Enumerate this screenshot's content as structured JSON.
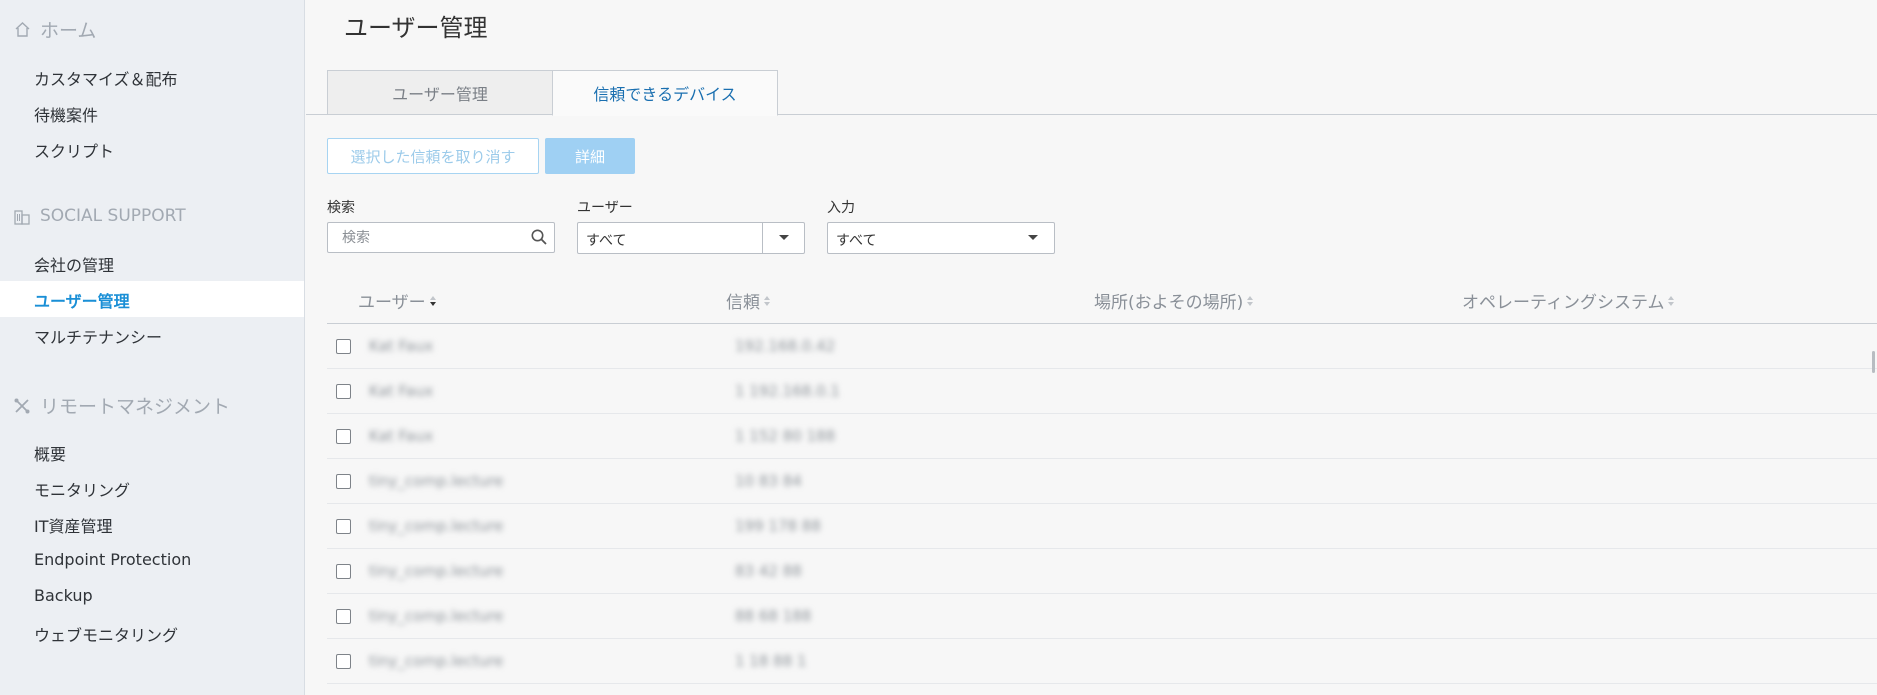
{
  "sidebar": {
    "home": {
      "label": "ホーム",
      "icon": "home-icon"
    },
    "home_items": [
      "カスタマイズ＆配布",
      "待機案件",
      "スクリプト"
    ],
    "social": {
      "label": "SOCIAL SUPPORT",
      "icon": "building-icon"
    },
    "social_items": [
      "会社の管理",
      "ユーザー管理",
      "マルチテナンシー"
    ],
    "remote": {
      "label": "リモートマネジメント",
      "icon": "tools-icon"
    },
    "remote_items": [
      "概要",
      "モニタリング",
      "IT資産管理",
      "Endpoint Protection",
      "Backup",
      "ウェブモニタリング"
    ],
    "active_item": "ユーザー管理"
  },
  "main": {
    "title": "ユーザー管理",
    "tabs": [
      {
        "label": "ユーザー管理",
        "active": false
      },
      {
        "label": "信頼できるデバイス",
        "active": true
      }
    ],
    "actions": {
      "revoke_label": "選択した信頼を取り消す",
      "details_label": "詳細"
    },
    "filters": {
      "search_label": "検索",
      "search_placeholder": "検索",
      "user_label": "ユーザー",
      "user_value": "すべて",
      "input_label": "入力",
      "input_value": "すべて"
    },
    "table": {
      "columns": [
        "ユーザー",
        "信頼",
        "場所(およその場所)",
        "オペレーティングシステム"
      ],
      "rows": [
        {
          "user": "Kat Faux",
          "trust": "192.168.0.42"
        },
        {
          "user": "Kat Faux",
          "trust": "1 192.168.0.1"
        },
        {
          "user": "Kat Faux",
          "trust": "1 152 80 188"
        },
        {
          "user": "tiny_comp.lecture",
          "trust": "10 83 84"
        },
        {
          "user": "tiny_comp.lecture",
          "trust": "199 178 88"
        },
        {
          "user": "tiny_comp.lecture",
          "trust": "83 42 88"
        },
        {
          "user": "tiny_comp.lecture",
          "trust": "88 68 188"
        },
        {
          "user": "tiny_comp.lecture",
          "trust": "1 18 88 1"
        }
      ]
    }
  },
  "colors": {
    "accent": "#1a8fd6",
    "sidebar_bg": "#eceff3",
    "primary_button": "#9fd0f3"
  }
}
